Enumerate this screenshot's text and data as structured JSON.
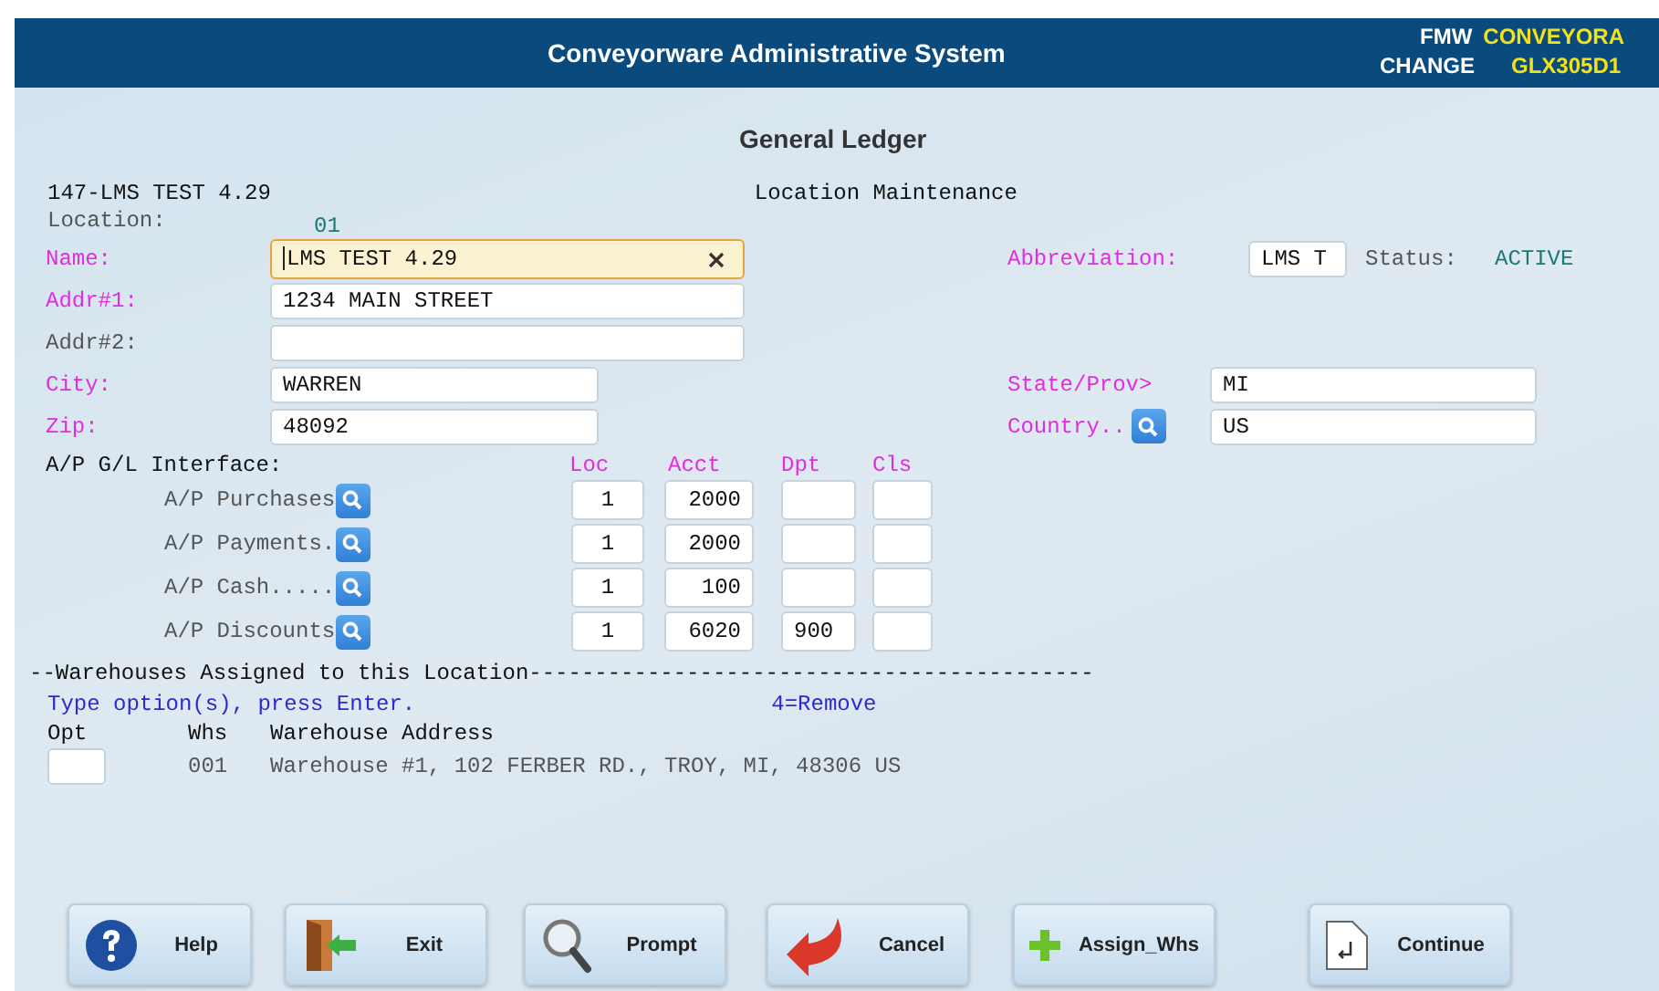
{
  "header": {
    "title": "Conveyorware Administrative System",
    "user_label": "FMW",
    "user": "CONVEYORA",
    "mode": "CHANGE",
    "program": "GLX305D1"
  },
  "page_title": "General Ledger",
  "company": "147-LMS TEST 4.29",
  "screen_name": "Location Maintenance",
  "location": {
    "label": "Location:",
    "value": "01"
  },
  "form_rows": [
    {
      "label": "Name:",
      "required": true,
      "value": "LMS TEST 4.29",
      "focused": true,
      "right": [
        {
          "kind": "field",
          "label": "Abbreviation:",
          "required": true,
          "value": "LMS T"
        },
        {
          "kind": "status",
          "label": "Status:",
          "value": "ACTIVE"
        }
      ]
    },
    {
      "label": "Addr#1:",
      "required": true,
      "value": "1234 MAIN STREET",
      "focused": false
    },
    {
      "label": "Addr#2:",
      "required": false,
      "focused": false
    },
    {
      "label": "City:",
      "required": true,
      "value": "WARREN",
      "focused": false,
      "right": [
        {
          "kind": "wide",
          "label": "State/Prov>",
          "required": true,
          "value": "MI"
        }
      ]
    },
    {
      "label": "Zip:",
      "required": true,
      "value": "48092",
      "focused": false,
      "right": [
        {
          "kind": "lookup",
          "label": "Country..",
          "required": true,
          "value": "US"
        }
      ]
    }
  ],
  "gl_interface": {
    "title": "A/P G/L Interface:",
    "columns": [
      "Loc",
      "Acct",
      "Dpt",
      "Cls"
    ],
    "rows": [
      {
        "label": "A/P Purchases",
        "loc": "1",
        "acct": "2000"
      },
      {
        "label": "A/P Payments.",
        "loc": "1",
        "acct": "2000"
      },
      {
        "label": "A/P Cash.....",
        "loc": "1",
        "acct": "100"
      },
      {
        "label": "A/P Discounts",
        "loc": "1",
        "acct": "6020",
        "dpt": "900"
      }
    ]
  },
  "warehouses": {
    "heading": "--Warehouses Assigned to this Location-------------------------------------------",
    "instruction": "Type option(s), press Enter.",
    "options": "4=Remove",
    "columns": [
      "Opt",
      "Whs",
      "Warehouse Address"
    ],
    "rows": [
      {
        "whs": "001",
        "address": "Warehouse #1, 102 FERBER RD., TROY, MI, 48306 US"
      }
    ]
  },
  "buttons": [
    {
      "kind": "help",
      "label": "Help"
    },
    {
      "kind": "exit",
      "label": "Exit"
    },
    {
      "kind": "prompt",
      "label": "Prompt"
    },
    {
      "kind": "cancel",
      "label": "Cancel"
    },
    {
      "kind": "add",
      "label": "Assign_Whs"
    },
    {
      "kind": "continue",
      "label": "Continue"
    }
  ]
}
